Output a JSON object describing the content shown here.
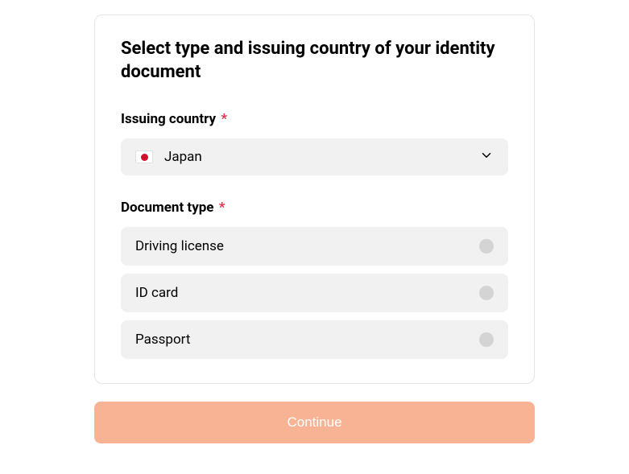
{
  "heading": "Select type and issuing country of your identity document",
  "issuing_country": {
    "label": "Issuing country",
    "required_mark": "*",
    "selected_value": "Japan",
    "flag_icon": "japan-flag"
  },
  "document_type": {
    "label": "Document type",
    "required_mark": "*",
    "options": [
      {
        "label": "Driving license"
      },
      {
        "label": "ID card"
      },
      {
        "label": "Passport"
      }
    ]
  },
  "continue_button": {
    "label": "Continue"
  },
  "colors": {
    "accent": "#f8b395",
    "required": "#e03149",
    "option_bg": "#f1f1f1",
    "radio_bg": "#d4d4d4"
  }
}
